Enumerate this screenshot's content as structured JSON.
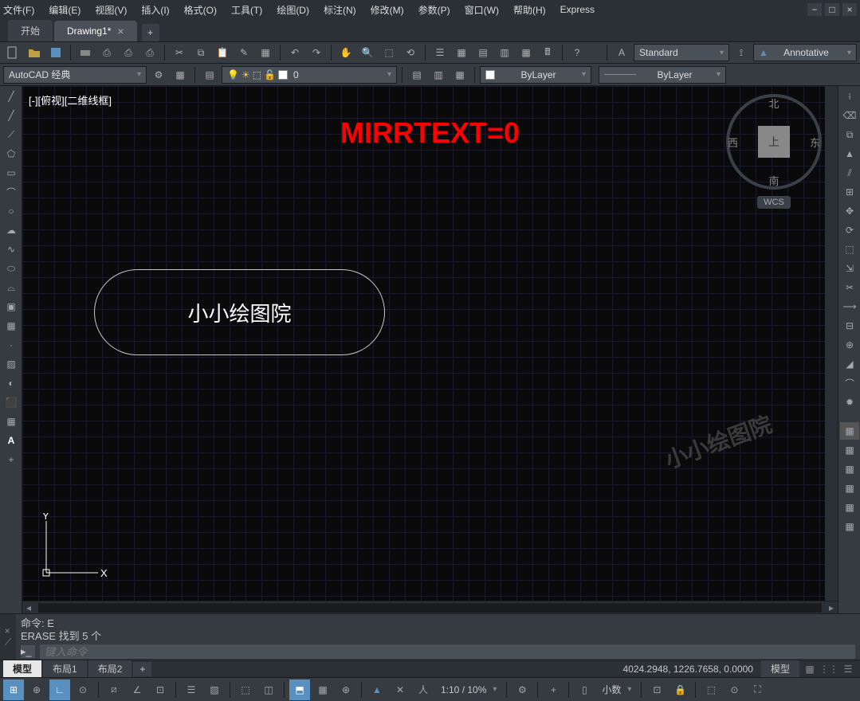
{
  "menubar": {
    "items": [
      "文件(F)",
      "编辑(E)",
      "视图(V)",
      "插入(I)",
      "格式(O)",
      "工具(T)",
      "绘图(D)",
      "标注(N)",
      "修改(M)",
      "参数(P)",
      "窗口(W)",
      "帮助(H)",
      "Express"
    ]
  },
  "tabs": {
    "start": "开始",
    "active": "Drawing1*"
  },
  "toolbar1": {
    "text_style": "Standard",
    "dim_style": "Annotative"
  },
  "toolbar2": {
    "workspace": "AutoCAD 经典",
    "layer_name": "0",
    "layer_color": "ByLayer",
    "linetype": "ByLayer"
  },
  "canvas": {
    "view_label": "[-][俯视][二维线框]",
    "overlay": "MIRRTEXT=0",
    "watermark": "小小绘图院",
    "stadium_text": "小小绘图院",
    "compass": {
      "n": "北",
      "s": "南",
      "w": "西",
      "e": "东",
      "top": "上"
    },
    "wcs": "WCS",
    "ucs": {
      "y": "Y",
      "x": "X"
    }
  },
  "command": {
    "line1": "命令: E",
    "line2": "ERASE 找到 5 个",
    "placeholder": "键入命令"
  },
  "layout": {
    "tabs": [
      "模型",
      "布局1",
      "布局2"
    ],
    "coords": "4024.2948, 1226.7658, 0.0000",
    "model_label": "模型"
  },
  "bottom": {
    "scale": "1:10 / 10%",
    "precision": "小数"
  }
}
